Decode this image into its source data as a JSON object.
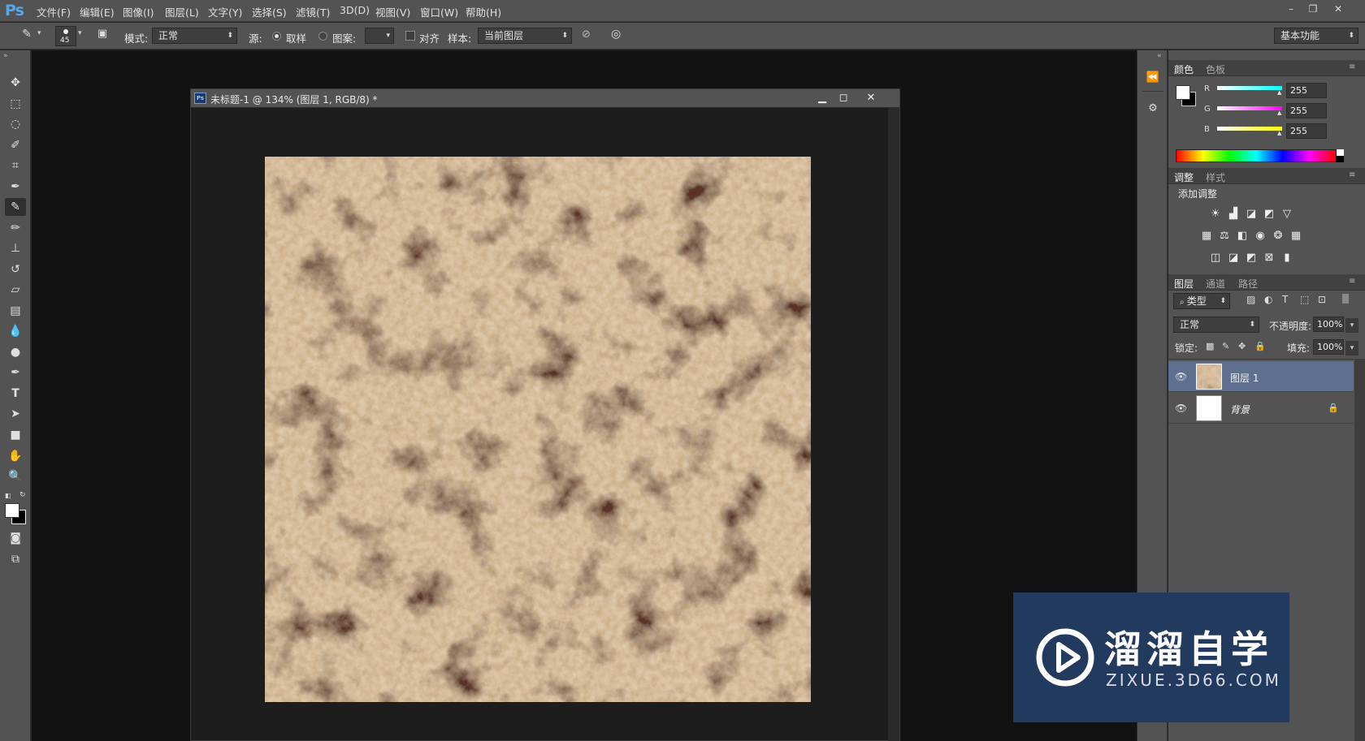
{
  "app": {
    "logo": "Ps"
  },
  "menu": [
    "文件(F)",
    "编辑(E)",
    "图像(I)",
    "图层(L)",
    "文字(Y)",
    "选择(S)",
    "滤镜(T)",
    "3D(D)",
    "视图(V)",
    "窗口(W)",
    "帮助(H)"
  ],
  "options": {
    "brush_size": "45",
    "mode_label": "模式:",
    "mode_value": "正常",
    "source_label": "源:",
    "sampled_label": "取样",
    "pattern_label": "图案:",
    "aligned_label": "对齐",
    "sample_label": "样本:",
    "sample_value": "当前图层",
    "workspace_value": "基本功能"
  },
  "document": {
    "title": "未标题-1 @ 134% (图层 1, RGB/8) *"
  },
  "color_panel": {
    "tabs": [
      "颜色",
      "色板"
    ],
    "channels": [
      {
        "label": "R",
        "value": "255",
        "color": "#00ffff"
      },
      {
        "label": "G",
        "value": "255",
        "color": "#ff00ff"
      },
      {
        "label": "B",
        "value": "255",
        "color": "#ffff00"
      }
    ]
  },
  "adjustments_panel": {
    "tabs": [
      "调整",
      "样式"
    ],
    "heading": "添加调整"
  },
  "layers_panel": {
    "tabs": [
      "图层",
      "通道",
      "路径"
    ],
    "filter_value": "类型",
    "blend_mode": "正常",
    "opacity_label": "不透明度:",
    "opacity_value": "100%",
    "lock_label": "锁定:",
    "fill_label": "填充:",
    "fill_value": "100%",
    "layers": [
      {
        "name": "图层 1",
        "selected": true
      },
      {
        "name": "背景",
        "selected": false,
        "locked": true
      }
    ]
  },
  "watermark": {
    "title": "溜溜自学",
    "subtitle": "ZIXUE.3D66.COM"
  }
}
